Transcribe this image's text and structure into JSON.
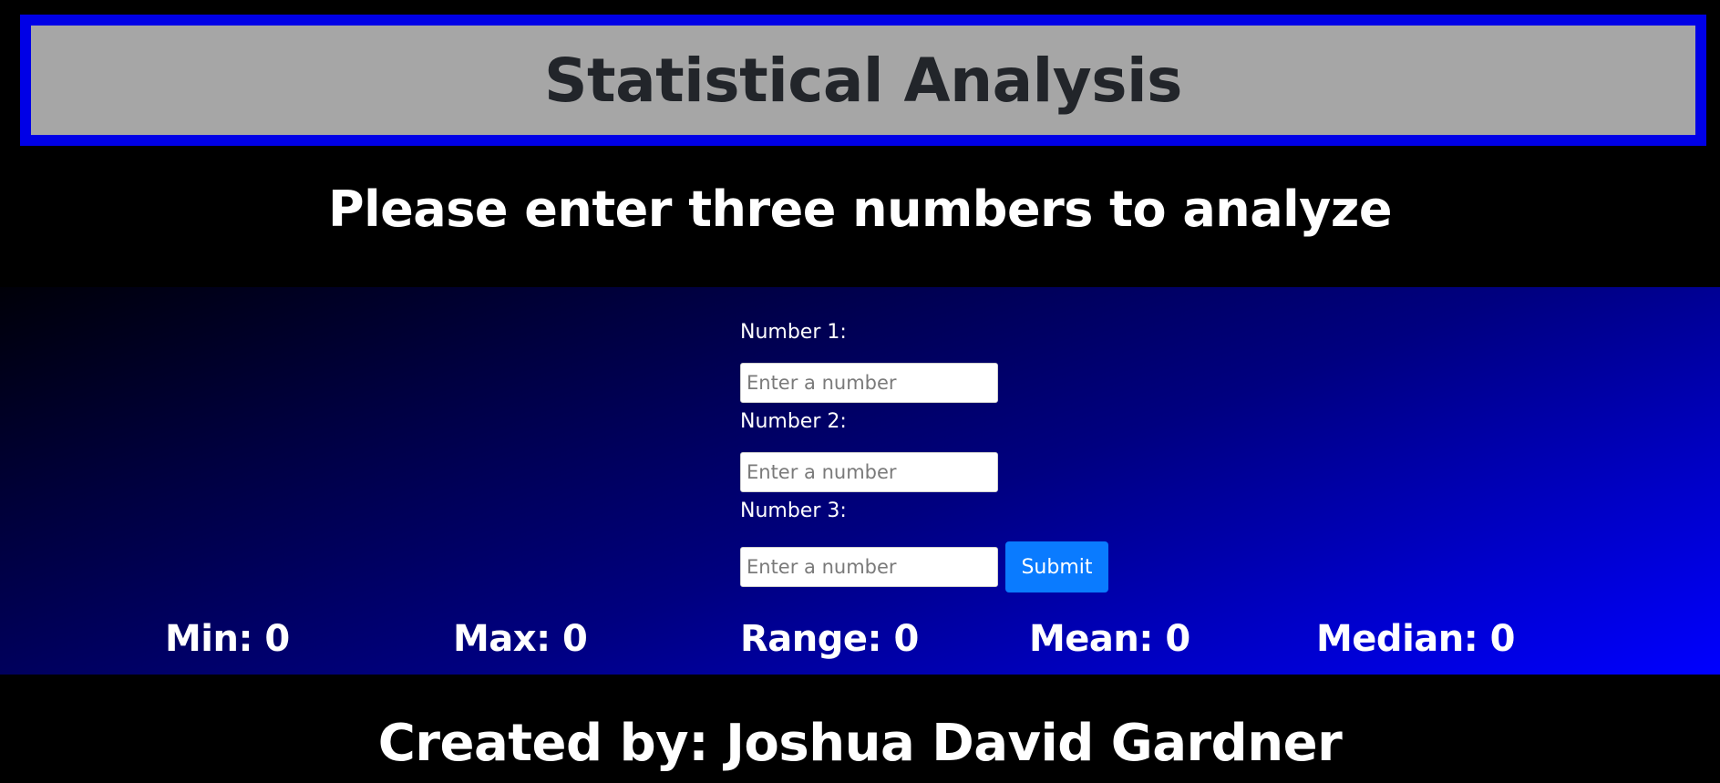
{
  "header": {
    "title": "Statistical Analysis"
  },
  "subtitle": "Please enter three numbers to analyze",
  "form": {
    "fields": [
      {
        "label": "Number 1:",
        "placeholder": "Enter a number",
        "value": ""
      },
      {
        "label": "Number 2:",
        "placeholder": "Enter a number",
        "value": ""
      },
      {
        "label": "Number 3:",
        "placeholder": "Enter a number",
        "value": ""
      }
    ],
    "submit_label": "Submit"
  },
  "stats": {
    "min": "Min: 0",
    "max": "Max: 0",
    "range": "Range: 0",
    "mean": "Mean: 0",
    "median": "Median: 0"
  },
  "footer": {
    "credit": "Created by: Joshua David Gardner"
  },
  "colors": {
    "header_border": "#0000e6",
    "header_background": "#a6a6a6",
    "title_text": "#22252a",
    "page_background": "#000000",
    "gradient_end": "#0000ff",
    "submit_button": "#0a7bff"
  }
}
